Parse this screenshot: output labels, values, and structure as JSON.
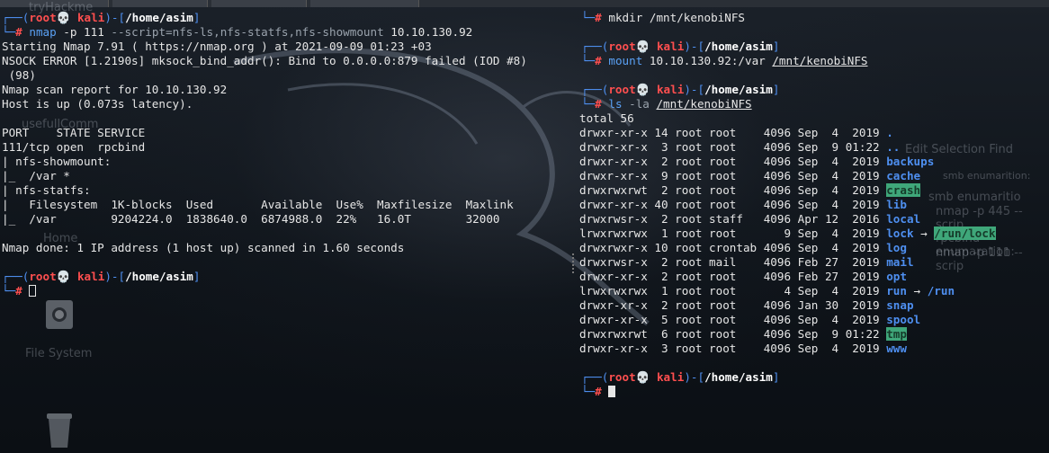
{
  "desktop": {
    "labels": [
      "tryHackme",
      "usefullComm",
      "Home",
      "File System"
    ],
    "ghost_text": [
      "Edit   Selection   Find",
      "smb enumarition:",
      "smb enumaritio",
      "nmap -p 445 --scrip",
      "rpcbind enumaration:",
      "nmap -p 111 --scrip"
    ]
  },
  "prompt": {
    "open": "┌──(",
    "user": "root",
    "skull": "💀",
    "host": "kali",
    "close": ")-[",
    "cwd": "/home/asim",
    "end": "]",
    "corner": "└─",
    "hash": "#"
  },
  "left": {
    "cmd1": {
      "name": "nmap",
      "args": " -p 111 ",
      "script": "--script=nfs-ls,nfs-statfs,nfs-showmount",
      "target": " 10.10.130.92"
    },
    "output": [
      "Starting Nmap 7.91 ( https://nmap.org ) at 2021-09-09 01:23 +03",
      "NSOCK ERROR [1.2190s] mksock_bind_addr(): Bind to 0.0.0.0:879 failed (IOD #8)",
      " (98)",
      "Nmap scan report for 10.10.130.92",
      "Host is up (0.073s latency).",
      "",
      "PORT    STATE SERVICE",
      "111/tcp open  rpcbind",
      "| nfs-showmount:",
      "|_  /var *",
      "| nfs-statfs:",
      "|   Filesystem  1K-blocks  Used       Available  Use%  Maxfilesize  Maxlink",
      "|_  /var        9204224.0  1838640.0  6874988.0  22%   16.0T        32000",
      "",
      "Nmap done: 1 IP address (1 host up) scanned in 1.60 seconds"
    ]
  },
  "right": {
    "cmd_mkdir": {
      "name": "mkdir",
      "arg": " /mnt/kenobiNFS"
    },
    "cmd_mount": {
      "name": "mount",
      "arg1": " 10.10.130.92:/var ",
      "arg2": "/mnt/kenobiNFS"
    },
    "cmd_ls": {
      "name": "ls",
      "flag": " -la ",
      "arg": "/mnt/kenobiNFS"
    },
    "total": "total 56",
    "listing": [
      {
        "meta": "drwxr-xr-x 14 root root    4096 Sep  4  2019 ",
        "name": ".",
        "style": "dir",
        "target": ""
      },
      {
        "meta": "drwxr-xr-x  3 root root    4096 Sep  9 01:22 ",
        "name": "..",
        "style": "dir",
        "target": ""
      },
      {
        "meta": "drwxr-xr-x  2 root root    4096 Sep  4  2019 ",
        "name": "backups",
        "style": "dir",
        "target": ""
      },
      {
        "meta": "drwxr-xr-x  9 root root    4096 Sep  4  2019 ",
        "name": "cache",
        "style": "dir",
        "target": ""
      },
      {
        "meta": "drwxrwxrwt  2 root root    4096 Sep  4  2019 ",
        "name": "crash",
        "style": "sticky",
        "target": ""
      },
      {
        "meta": "drwxr-xr-x 40 root root    4096 Sep  4  2019 ",
        "name": "lib",
        "style": "dir",
        "target": ""
      },
      {
        "meta": "drwxrwsr-x  2 root staff   4096 Apr 12  2016 ",
        "name": "local",
        "style": "dir",
        "target": ""
      },
      {
        "meta": "lrwxrwxrwx  1 root root       9 Sep  4  2019 ",
        "name": "lock",
        "style": "link",
        "target": "/run/lock",
        "target_style": "sticky"
      },
      {
        "meta": "drwxrwxr-x 10 root crontab 4096 Sep  4  2019 ",
        "name": "log",
        "style": "dir",
        "target": ""
      },
      {
        "meta": "drwxrwsr-x  2 root mail    4096 Feb 27  2019 ",
        "name": "mail",
        "style": "dir",
        "target": ""
      },
      {
        "meta": "drwxr-xr-x  2 root root    4096 Feb 27  2019 ",
        "name": "opt",
        "style": "dir",
        "target": ""
      },
      {
        "meta": "lrwxrwxrwx  1 root root       4 Sep  4  2019 ",
        "name": "run",
        "style": "link",
        "target": "/run",
        "target_style": "dir"
      },
      {
        "meta": "drwxr-xr-x  2 root root    4096 Jan 30  2019 ",
        "name": "snap",
        "style": "dir",
        "target": ""
      },
      {
        "meta": "drwxr-xr-x  5 root root    4096 Sep  4  2019 ",
        "name": "spool",
        "style": "dir",
        "target": ""
      },
      {
        "meta": "drwxrwxrwt  6 root root    4096 Sep  9 01:22 ",
        "name": "tmp",
        "style": "sticky",
        "target": ""
      },
      {
        "meta": "drwxr-xr-x  3 root root    4096 Sep  4  2019 ",
        "name": "www",
        "style": "dir",
        "target": ""
      }
    ],
    "arrow": " → "
  },
  "colors": {
    "prompt_blue": "#4e8ff0",
    "root_red": "#ff4f4f",
    "sticky_bg": "#3fa77a"
  }
}
